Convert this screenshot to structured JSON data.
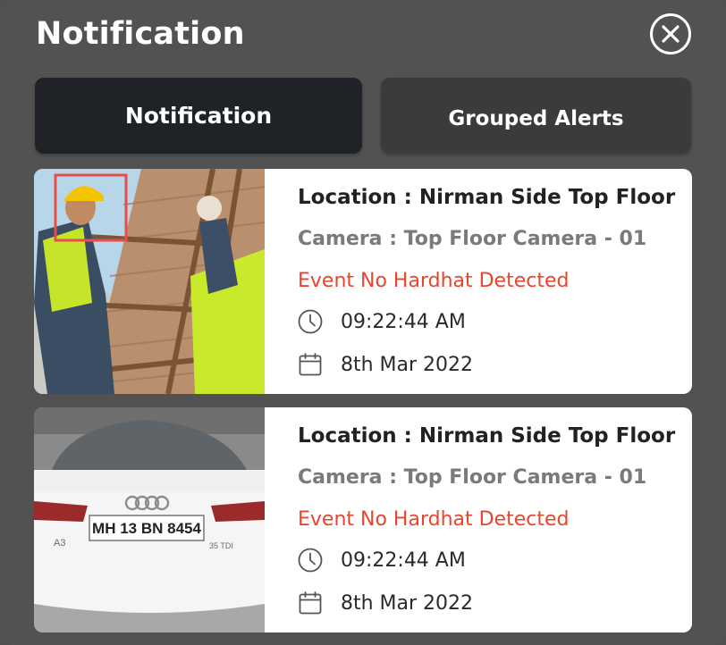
{
  "window": {
    "title": "Notification"
  },
  "tabs": [
    {
      "label": "Notification",
      "active": true
    },
    {
      "label": "Grouped Alerts",
      "active": false
    }
  ],
  "alerts": [
    {
      "image": "worker-on-scaffolding-photo",
      "location": "Location : Nirman Side Top Floor",
      "camera": "Camera : Top Floor Camera - 01",
      "event": "Event No Hardhat Detected",
      "time": "09:22:44 AM",
      "date": "8th Mar 2022"
    },
    {
      "image": "white-car-rear-photo",
      "plate": "MH 13 BN 8454",
      "location": "Location : Nirman Side Top Floor",
      "camera": "Camera : Top Floor Camera - 01",
      "event": "Event No Hardhat Detected",
      "time": "09:22:44 AM",
      "date": "8th Mar 2022"
    }
  ],
  "icons": {
    "close": "close-circle-icon",
    "time": "clock-icon",
    "date": "calendar-icon"
  },
  "colors": {
    "panel": "#525252",
    "active_tab": "#1f2226",
    "inactive_tab": "#3a3b3d",
    "event": "#e8452e"
  }
}
